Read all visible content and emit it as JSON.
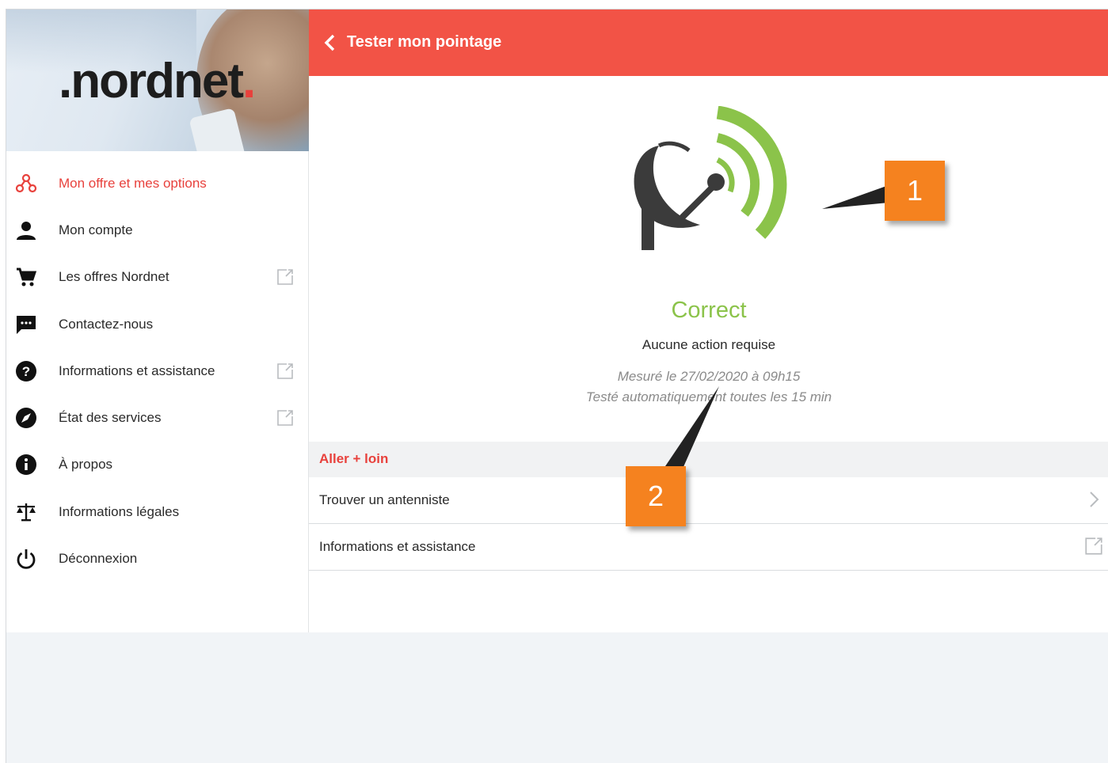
{
  "logo": {
    "text": "nordnet",
    "prefix": ".",
    "suffix": "."
  },
  "header": {
    "title": "Tester mon pointage",
    "back_icon": "chevron-left-icon"
  },
  "sidebar": {
    "items": [
      {
        "label": "Mon offre et mes options",
        "icon": "options-nodes-icon",
        "active": true,
        "external": false
      },
      {
        "label": "Mon compte",
        "icon": "person-icon",
        "active": false,
        "external": false
      },
      {
        "label": "Les offres Nordnet",
        "icon": "cart-icon",
        "active": false,
        "external": true
      },
      {
        "label": "Contactez-nous",
        "icon": "chat-icon",
        "active": false,
        "external": false
      },
      {
        "label": "Informations et assistance",
        "icon": "help-icon",
        "active": false,
        "external": true
      },
      {
        "label": "État des services",
        "icon": "compass-icon",
        "active": false,
        "external": true
      },
      {
        "label": "À propos",
        "icon": "info-icon",
        "active": false,
        "external": false
      },
      {
        "label": "Informations légales",
        "icon": "scale-icon",
        "active": false,
        "external": false
      },
      {
        "label": "Déconnexion",
        "icon": "power-icon",
        "active": false,
        "external": false
      }
    ]
  },
  "main": {
    "status": "Correct",
    "subtitle": "Aucune action requise",
    "measured": "Mesuré le 27/02/2020 à 09h15",
    "autotest": "Testé automatiquement toutes les 15 min",
    "section_title": "Aller + loin",
    "rows": [
      {
        "label": "Trouver un antenniste",
        "trail": "chevron-right-icon"
      },
      {
        "label": "Informations et assistance",
        "trail": "external-link-icon"
      }
    ]
  },
  "callouts": {
    "one": "1",
    "two": "2"
  },
  "colors": {
    "accent": "#f25346",
    "active_text": "#e8413c",
    "ok": "#8bc34a",
    "callout": "#f5821f"
  }
}
